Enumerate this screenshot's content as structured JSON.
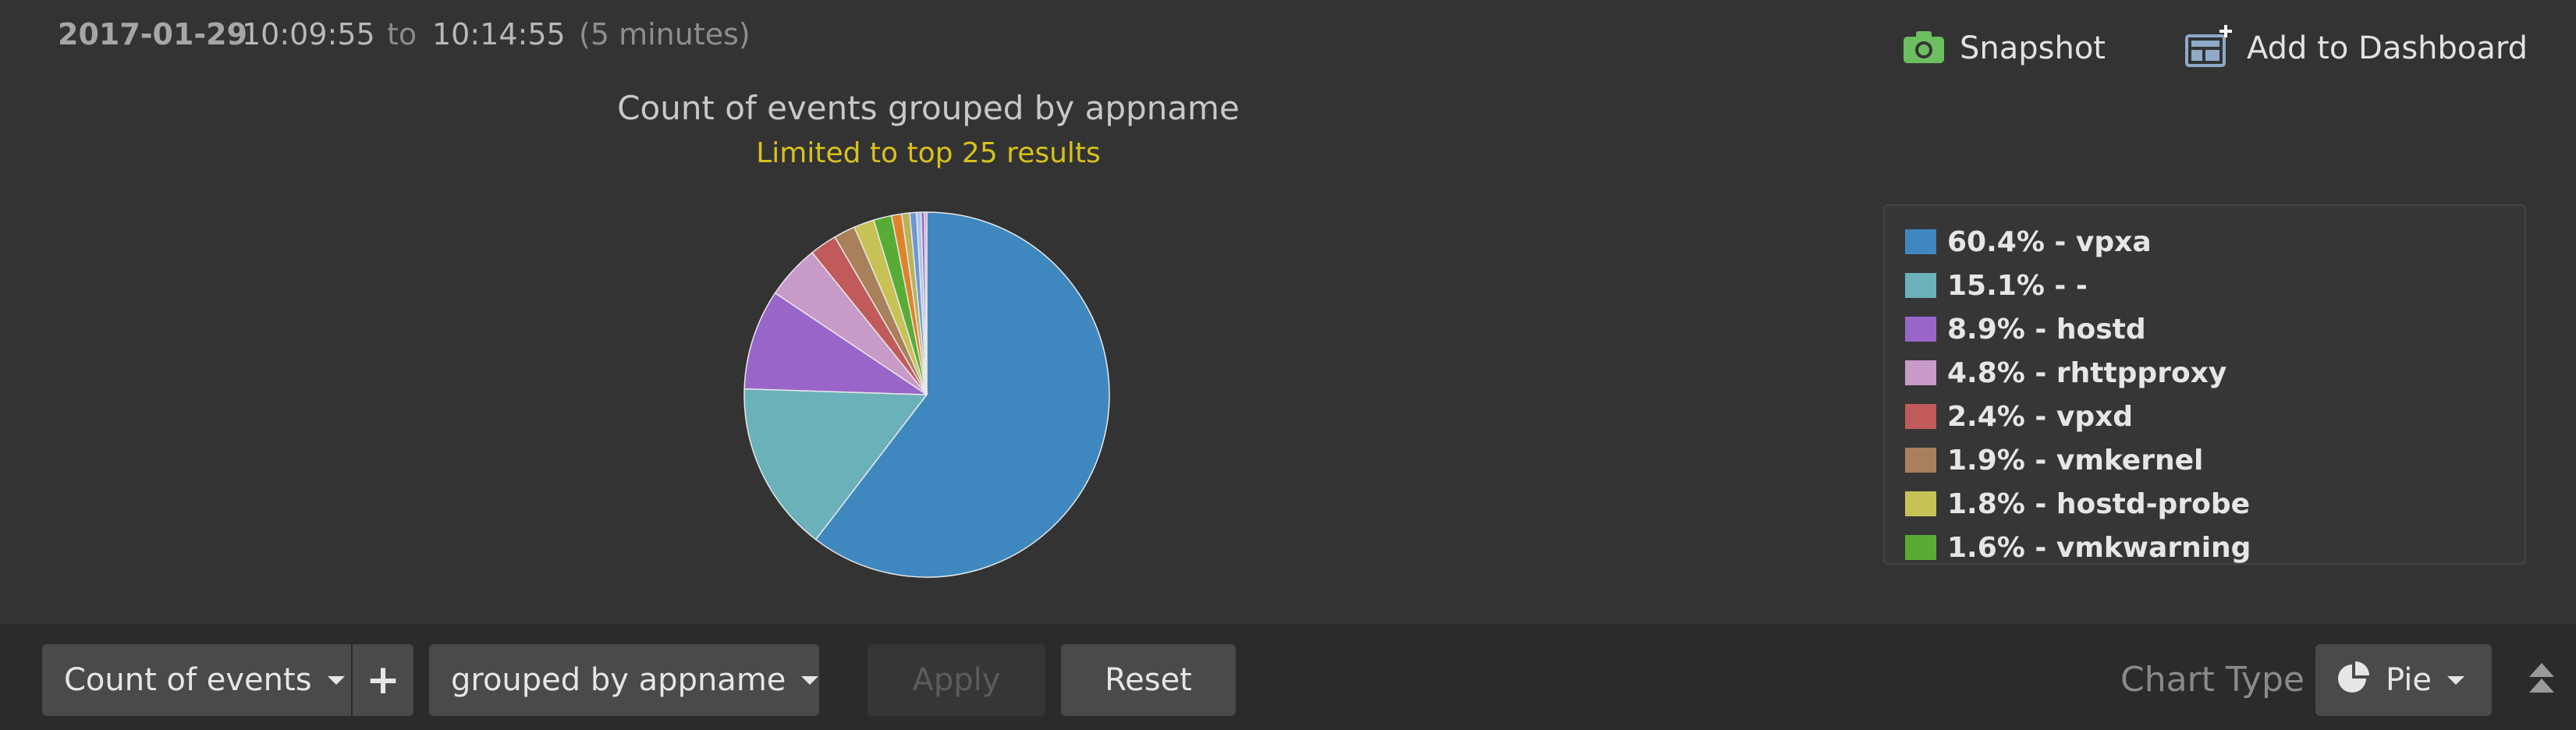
{
  "time_range": {
    "date": "2017-01-29",
    "start": "10:09:55",
    "to_label": "to",
    "end": "10:14:55",
    "duration": "(5 minutes)"
  },
  "header_actions": {
    "snapshot_label": "Snapshot",
    "add_dashboard_label": "Add to Dashboard"
  },
  "toolbar": {
    "aggregate_label": "Count of events",
    "add_label": "+",
    "group_label": "grouped by appname",
    "apply_label": "Apply",
    "reset_label": "Reset",
    "chart_type_label": "Chart Type",
    "chart_type_value": "Pie"
  },
  "legend": {
    "items": [
      {
        "label": "60.4% - vpxa",
        "color": "#3f88bf"
      },
      {
        "label": "15.1% - -",
        "color": "#6bb1ba"
      },
      {
        "label": "8.9% - hostd",
        "color": "#9a65c8"
      },
      {
        "label": "4.8% - rhttpproxy",
        "color": "#c89ac8"
      },
      {
        "label": "2.4% - vpxd",
        "color": "#c15a5a"
      },
      {
        "label": "1.9% - vmkernel",
        "color": "#a9805c"
      },
      {
        "label": "1.8% - hostd-probe",
        "color": "#c7c255"
      },
      {
        "label": "1.6% - vmkwarning",
        "color": "#58ac35"
      }
    ]
  },
  "chart_data": {
    "type": "pie",
    "title": "Count of events grouped by appname",
    "subtitle": "Limited to top 25 results",
    "categories": [
      "vpxa",
      "-",
      "hostd",
      "rhttpproxy",
      "vpxd",
      "vmkernel",
      "hostd-probe",
      "vmkwarning",
      "",
      "",
      "",
      "",
      "",
      ""
    ],
    "values": [
      60.4,
      15.1,
      8.9,
      4.8,
      2.4,
      1.9,
      1.8,
      1.6,
      0.9,
      0.7,
      0.6,
      0.4,
      0.3,
      0.2
    ],
    "colors": [
      "#3f88bf",
      "#6bb1ba",
      "#9a65c8",
      "#c89ac8",
      "#c15a5a",
      "#a9805c",
      "#c7c255",
      "#58ac35",
      "#e0822b",
      "#b9b45a",
      "#6f96d6",
      "#a3c8e8",
      "#9a65c8",
      "#c89ac8"
    ],
    "title_color": "#c8c8c8",
    "subtitle_color": "#d8c11a"
  }
}
